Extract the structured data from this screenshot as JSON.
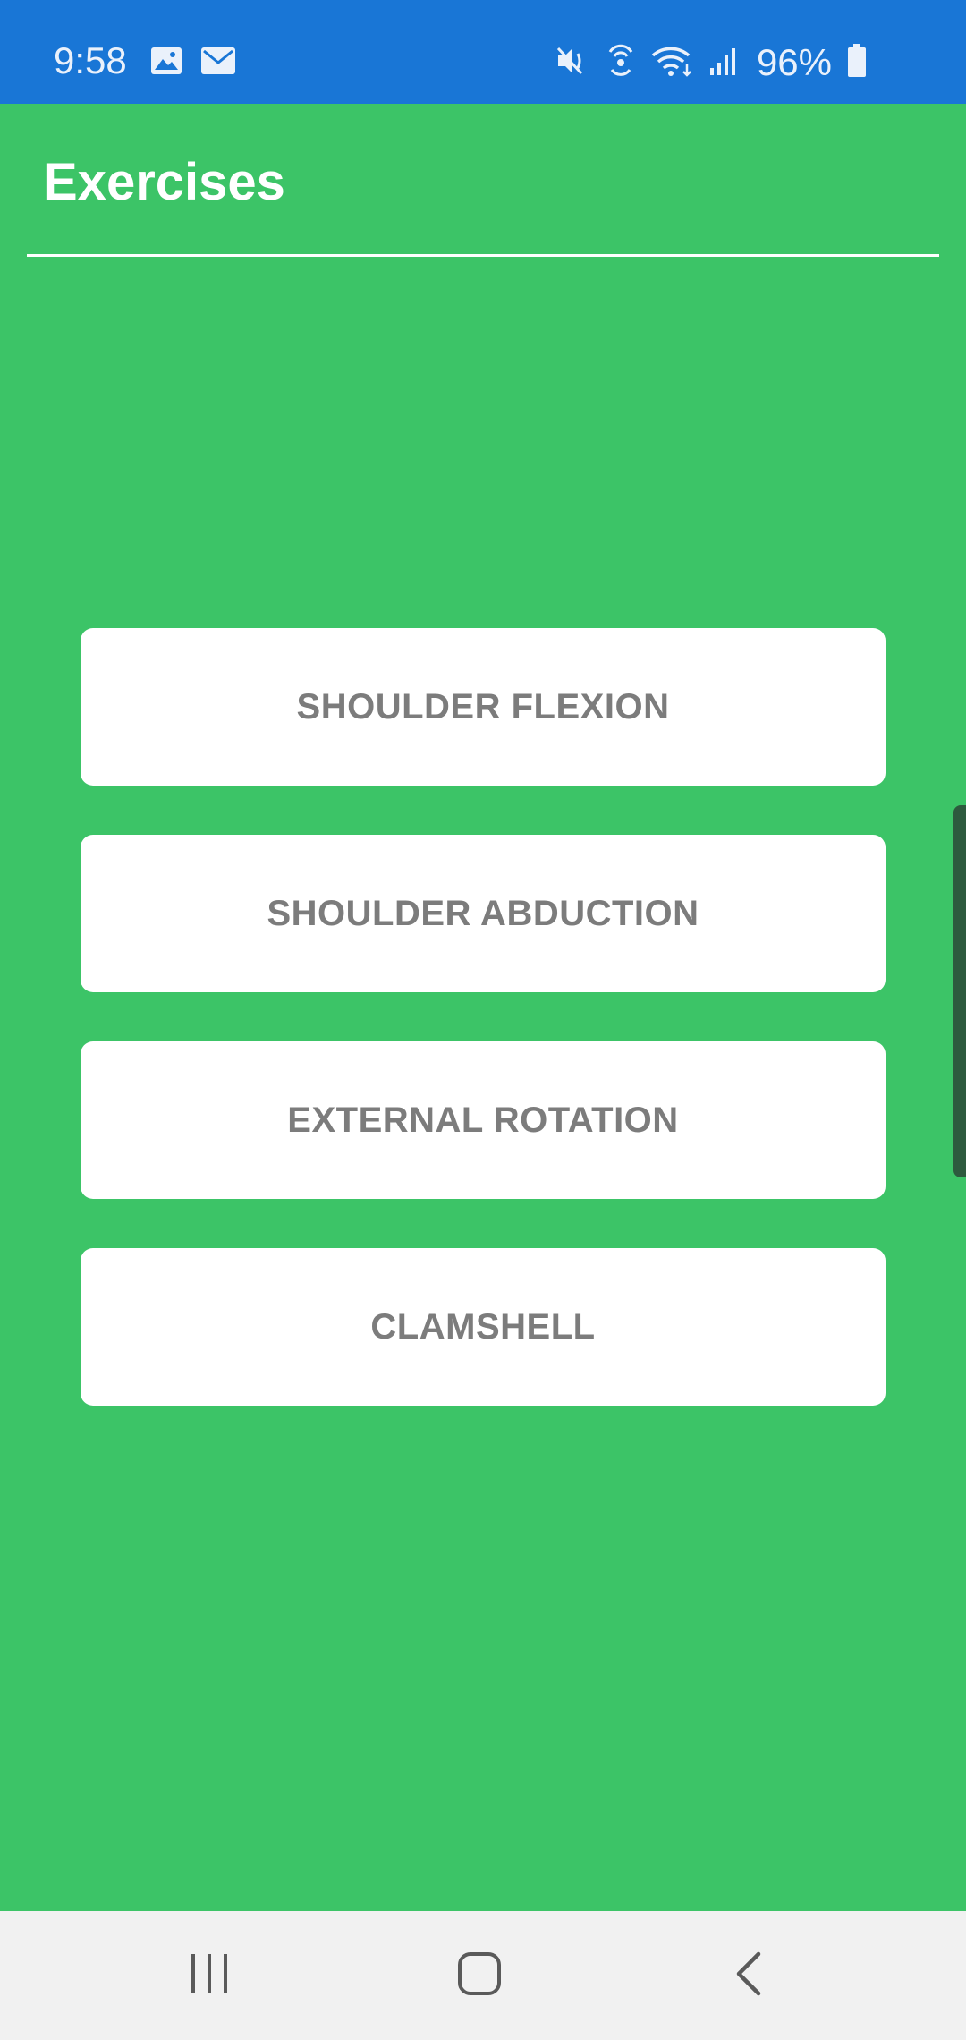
{
  "status_bar": {
    "time": "9:58",
    "battery_percent": "96%",
    "left_icons": [
      "gallery-icon",
      "mail-icon"
    ],
    "right_icons": [
      "mute-icon",
      "hotspot-icon",
      "wifi-icon",
      "signal-icon",
      "battery-icon"
    ],
    "background_color": "#1976d6"
  },
  "header": {
    "title": "Exercises"
  },
  "exercises": [
    {
      "label": "SHOULDER FLEXION"
    },
    {
      "label": "SHOULDER ABDUCTION"
    },
    {
      "label": "EXTERNAL ROTATION"
    },
    {
      "label": "CLAMSHELL"
    }
  ],
  "colors": {
    "app_background": "#3cc467",
    "button_background": "#ffffff",
    "button_text": "#7c7c7c",
    "nav_background": "#f1f1f1"
  },
  "nav_bar": {
    "buttons": [
      "recent-apps-icon",
      "home-icon",
      "back-icon"
    ]
  }
}
